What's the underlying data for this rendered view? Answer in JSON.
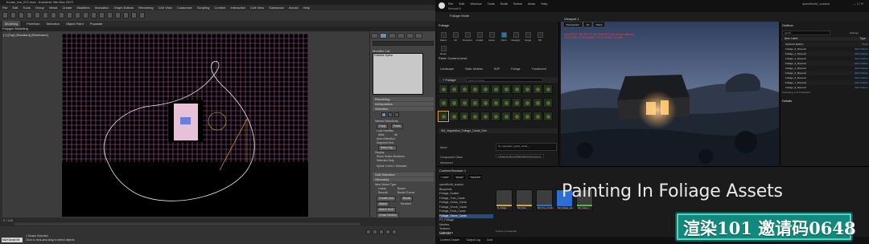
{
  "max": {
    "title": "house_rea_072.max - Autodesk 3ds Max 2023",
    "menu": [
      "File",
      "Edit",
      "Tools",
      "Group",
      "Views",
      "Create",
      "Modifiers",
      "Animation",
      "Graph Editors",
      "Rendering",
      "Civil View",
      "Customize",
      "Scripting",
      "Content",
      "Interactive",
      "Civil View",
      "Substance",
      "Arnold",
      "Help"
    ],
    "ribbon": [
      "Modeling",
      "Freeform",
      "Selection",
      "Object Paint",
      "Populate"
    ],
    "ribbon_sub": "Polygon Modeling",
    "viewport_label": "[+] [Top] [Standard] [Wireframe]",
    "command_panel": {
      "modifier_list": "Modifier List",
      "stack_item": "Editable Spline",
      "rollouts": [
        "Rendering",
        "Interpolation",
        "Selection"
      ],
      "selection_rows": [
        "Named Selections:",
        "Copy",
        "Paste",
        "Lock Handles",
        "Alike",
        "All",
        "Area Selection:",
        "Segment End",
        "Select By...",
        "Display",
        "Show Vertex Numbers",
        "Selected Only",
        "Spline 1/Vert 1 Selected"
      ],
      "soft_selection": "Soft Selection",
      "geometry": "Geometry",
      "geometry_rows": [
        "New Vertex Type",
        "Linear",
        "Bezier",
        "Smooth",
        "Bezier Corner",
        "Create Line",
        "Break",
        "Attach",
        "Reorient",
        "Attach Mult.",
        "Cross Section"
      ]
    },
    "frame_counter": "0 / 100",
    "maxscript": "MAXScript Mi",
    "status_prompt": "1 Shape Selected",
    "status_hint": "Click or click-and-drag to select objects"
  },
  "ue": {
    "menu": [
      "File",
      "Edit",
      "Window",
      "Tools",
      "Build",
      "Select",
      "Actor",
      "Help"
    ],
    "project": "RemoteSt",
    "mode_label": "Foliage Mode",
    "window_label": "openWorld_custom",
    "foliage": {
      "tab": "Foliage",
      "tools": [
        "Select",
        "All",
        "Deselect",
        "Invalid",
        "Lasso",
        "Paint",
        "Reapply",
        "Single",
        "Fill",
        "Erase"
      ],
      "section": "Paint: Current Level",
      "filters": [
        "Landscape",
        "Static Meshes",
        "BSP",
        "Foliage",
        "Translucent"
      ],
      "header": "+ Foliage",
      "search": "Search Foliage",
      "details_header": "SM_Vegetation_Foliage_Cards_Gen",
      "mesh_label": "Mesh",
      "mesh_value": "SI_vegetation_grass_cards_...",
      "component_label": "Component Class",
      "component_value": "FoliageInstancedStaticMeshComponent",
      "advanced": "Advanced"
    },
    "viewport": {
      "tab": "Viewport 1",
      "toolbar": [
        "Perspective",
        "Lit",
        "Show"
      ],
      "warning": [
        "LIGHTING NEEDS TO BE REBUILT (35 unbuilt objects)",
        "TEXTURE STREAMING POOL OVER 120 MB"
      ]
    },
    "outliner": {
      "tab": "Outliner",
      "search": "gardin",
      "settings": "Settings",
      "col_label": "Item Label",
      "col_type": "Type",
      "rows": [
        {
          "label": "MyWorld (Editor)",
          "type": "World"
        },
        {
          "label": "Foliage_0_MyLevel",
          "type": "Edit Outliner"
        },
        {
          "label": "Foliage_1_MyLevel",
          "type": "Edit Outliner"
        },
        {
          "label": "Foliage_2_MyLevel",
          "type": "Edit Outliner"
        },
        {
          "label": "Foliage_3_MyLevel",
          "type": "Edit Outliner"
        },
        {
          "label": "Foliage_4_MyLevel",
          "type": "Edit Outliner"
        },
        {
          "label": "Foliage_5_MyLevel",
          "type": "Edit Outliner"
        },
        {
          "label": "Foliage_6_MyLevel",
          "type": "Edit Outliner"
        },
        {
          "label": "Foliage_7_MyLevel",
          "type": "Edit Outliner"
        },
        {
          "label": "Foliage_8_MyLevel",
          "type": "Edit Outliner"
        }
      ],
      "count": "9 showing, 1 of 9 selected",
      "details_tab": "Details"
    },
    "content_browser": {
      "tab": "Content Browser 1",
      "toolbar": [
        "+ Add",
        "Import",
        "Save All"
      ],
      "tree": [
        "openWorld_custom",
        "Blueprints",
        "Foliage_Scatter",
        "Foliage_Tree_Cards",
        "Foliage_Grass_Cards",
        "Foliage_Shrub_Cards",
        "Foliage_Rock_Cards",
        "Foliage_Stone_Cards",
        "FX_Foliage",
        "Meshes",
        "Textures",
        "Materials"
      ],
      "tree_selected": 7,
      "assets": [
        "M_Foliage",
        "SM_Rock",
        "SM_Tree_Conifer",
        "SM_Foliage_Gen",
        "SM_Grass_1"
      ],
      "asset_colors": [
        "#d4a72c",
        "#d4a72c",
        "#2b6fd6",
        "#2b6fd6",
        "#54b83c"
      ],
      "selected_asset": 3,
      "items": "5 items (1 selected)",
      "collections": "Collections"
    },
    "bottom": [
      "Content Drawer",
      "Output Log",
      "Cmd"
    ],
    "bottom_right": "Derived Data   Source Control"
  },
  "caption": "Painting In Foliage Assets",
  "badge": "渲染101 邀请码0648",
  "colors": {
    "accent": "#1e72d6",
    "badge_bg": "#11897c",
    "warning": "#ff3b3b"
  }
}
